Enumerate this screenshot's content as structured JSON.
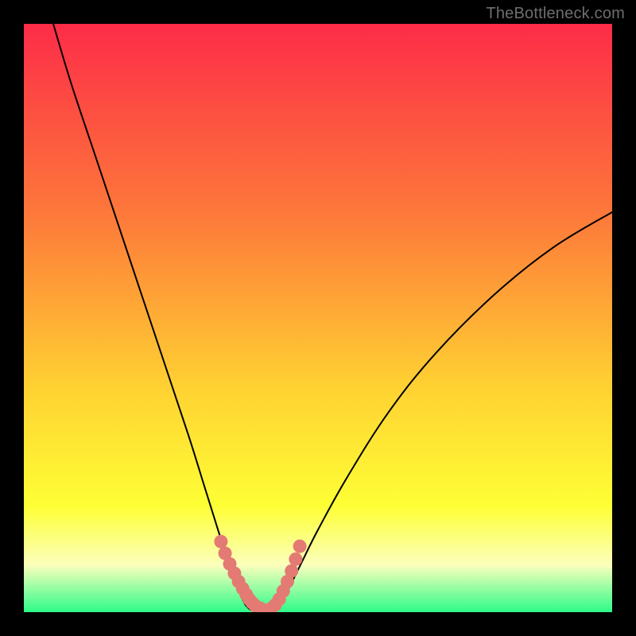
{
  "watermark": "TheBottleneck.com",
  "colors": {
    "bg": "#000000",
    "grad_top": "#fd2c48",
    "grad_mid1": "#fd7a3a",
    "grad_mid2": "#ffd232",
    "grad_mid3": "#feff35",
    "grad_mid4": "#fbffbc",
    "grad_bottom": "#2dfb89",
    "curve": "#000000",
    "bead": "#e47a74"
  },
  "chart_data": {
    "type": "line",
    "title": "",
    "xlabel": "",
    "ylabel": "",
    "xlim": [
      0,
      100
    ],
    "ylim": [
      0,
      100
    ],
    "series": [
      {
        "name": "left-curve",
        "x": [
          5,
          8,
          12,
          16,
          20,
          24,
          28,
          30.5,
          33,
          35,
          36.5,
          37.5,
          38.5
        ],
        "y": [
          100,
          90,
          78,
          66,
          54,
          42,
          30,
          22,
          14,
          8,
          4,
          1.5,
          0.4
        ]
      },
      {
        "name": "right-curve",
        "x": [
          42.5,
          43.5,
          45,
          47,
          50,
          55,
          62,
          70,
          80,
          90,
          100
        ],
        "y": [
          0.4,
          1.5,
          4,
          8,
          14,
          23,
          34,
          44,
          54,
          62,
          68
        ]
      },
      {
        "name": "valley-floor",
        "x": [
          38.5,
          42.5
        ],
        "y": [
          0.4,
          0.4
        ]
      }
    ],
    "beads": {
      "comment": "pink dotted segments near the valley",
      "left": {
        "x": [
          33.5,
          34.2,
          35.0,
          35.8,
          36.5,
          37.2,
          37.8,
          38.3,
          38.8,
          39.3,
          39.8,
          40.3
        ],
        "y": [
          12.0,
          10.0,
          8.2,
          6.6,
          5.2,
          4.0,
          3.0,
          2.2,
          1.6,
          1.1,
          0.8,
          0.6
        ]
      },
      "right": {
        "x": [
          42.0,
          42.7,
          43.4,
          44.1,
          44.8,
          45.5,
          46.2,
          46.9
        ],
        "y": [
          0.6,
          1.2,
          2.2,
          3.6,
          5.2,
          7.0,
          9.0,
          11.2
        ]
      }
    }
  }
}
